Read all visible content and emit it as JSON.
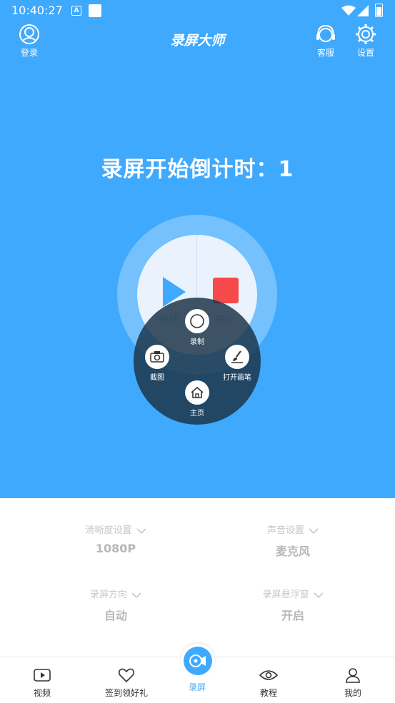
{
  "status_bar": {
    "time": "10:40:27",
    "a_icon": "A"
  },
  "header": {
    "title": "录屏大师",
    "login_label": "登录",
    "service_label": "客服",
    "settings_label": "设置"
  },
  "countdown_text": "录屏开始倒计时：1",
  "control": {
    "continue_label": "继续",
    "stop_label": "停止"
  },
  "float_menu": {
    "record_label": "录制",
    "screenshot_label": "截图",
    "brush_label": "打开画笔",
    "home_label": "主页"
  },
  "settings": {
    "clarity": {
      "label": "清晰度设置",
      "value": "1080P"
    },
    "sound": {
      "label": "声音设置",
      "value": "麦克风"
    },
    "orientation": {
      "label": "录屏方向",
      "value": "自动"
    },
    "floating_window": {
      "label": "录屏悬浮窗",
      "value": "开启"
    }
  },
  "tabs": [
    {
      "label": "视频",
      "icon": "video-icon"
    },
    {
      "label": "签到领好礼",
      "icon": "heart-icon"
    },
    {
      "label": "录屏",
      "icon": "record-icon"
    },
    {
      "label": "教程",
      "icon": "eye-icon"
    },
    {
      "label": "我的",
      "icon": "user-icon"
    }
  ],
  "colors": {
    "primary": "#3fa9fd",
    "stop": "#f5494a"
  }
}
